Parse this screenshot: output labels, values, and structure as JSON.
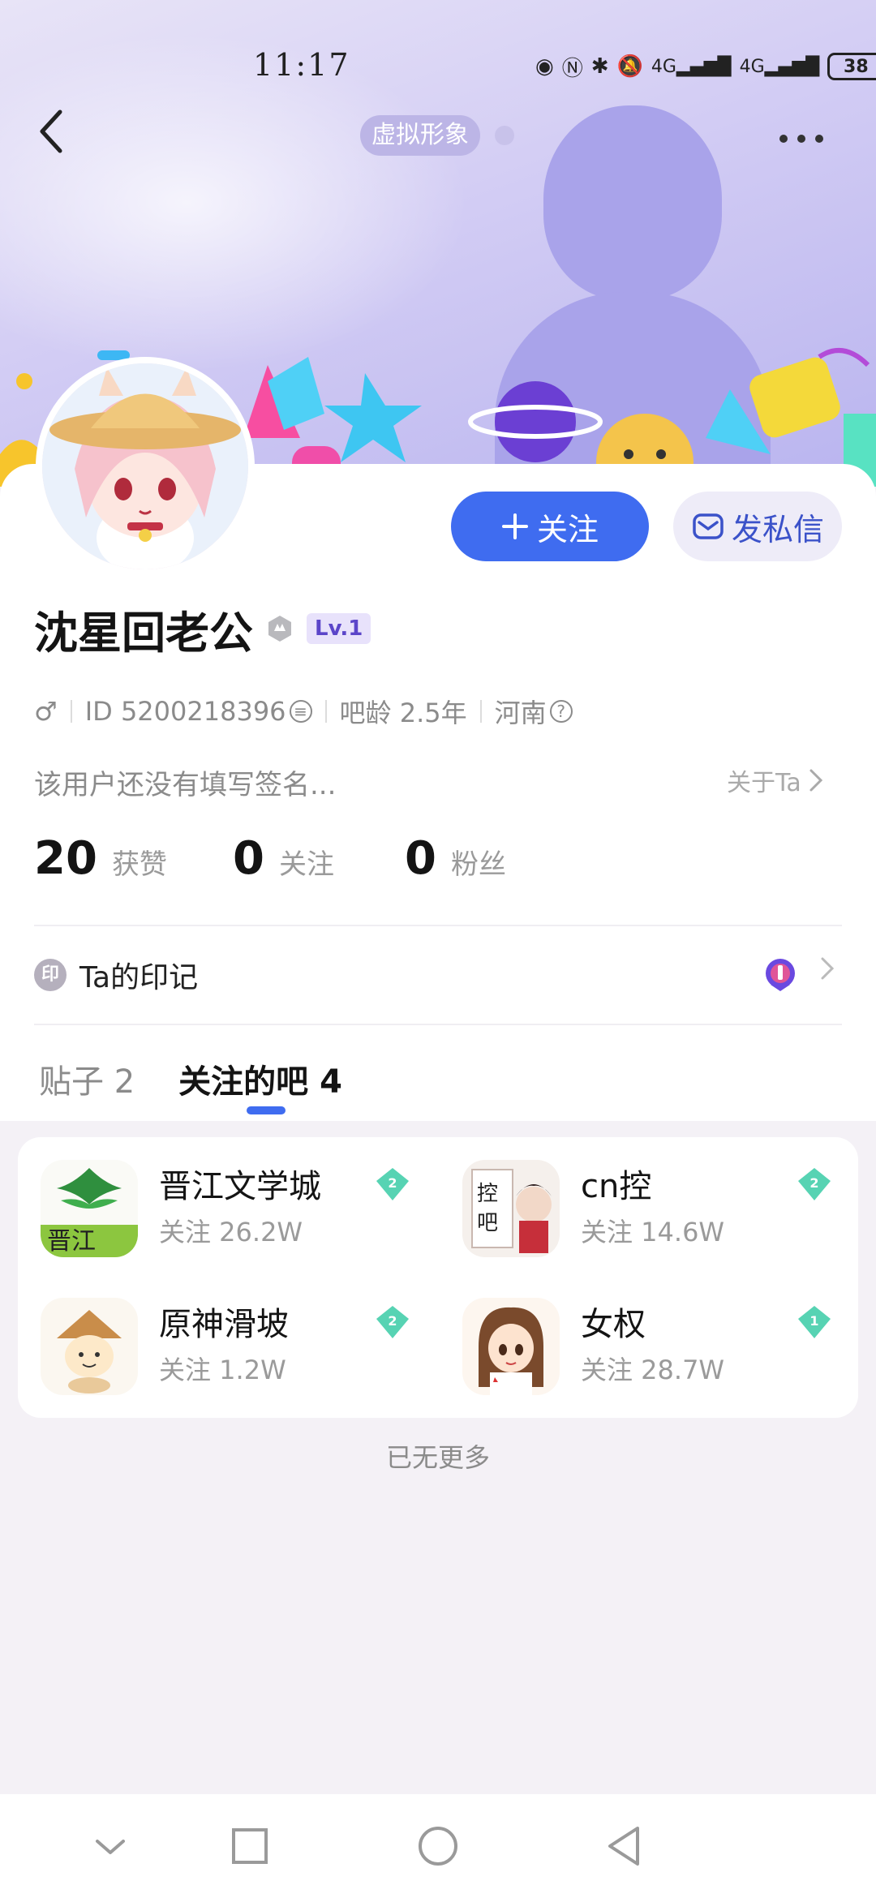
{
  "status_bar": {
    "time": "11:17",
    "battery": "38"
  },
  "header": {
    "avatar_pill_label": "虚拟形象"
  },
  "profile": {
    "username": "沈星回老公",
    "level_tag": "Lv.1",
    "id_label": "ID 5200218396",
    "bar_age": "吧龄 2.5年",
    "location": "河南",
    "signature": "该用户还没有填写签名...",
    "about_label": "关于Ta",
    "follow_button_label": "关注",
    "message_button_label": "发私信"
  },
  "stats": [
    {
      "value": "20",
      "label": "获赞"
    },
    {
      "value": "0",
      "label": "关注"
    },
    {
      "value": "0",
      "label": "粉丝"
    }
  ],
  "marks": {
    "icon_text": "印",
    "label": "Ta的印记"
  },
  "tabs": [
    {
      "label": "贴子 2",
      "active": false
    },
    {
      "label": "关注的吧 4",
      "active": true
    }
  ],
  "bars": [
    {
      "name": "晋江文学城",
      "followers": "关注 26.2W",
      "level": "2"
    },
    {
      "name": "cn控",
      "followers": "关注 14.6W",
      "level": "2"
    },
    {
      "name": "原神滑坡",
      "followers": "关注 1.2W",
      "level": "2"
    },
    {
      "name": "女权",
      "followers": "关注 28.7W",
      "level": "1"
    }
  ],
  "list_footer": "已无更多",
  "colors": {
    "accent": "#3f6cf0",
    "level_badge": "#57d3b3"
  }
}
